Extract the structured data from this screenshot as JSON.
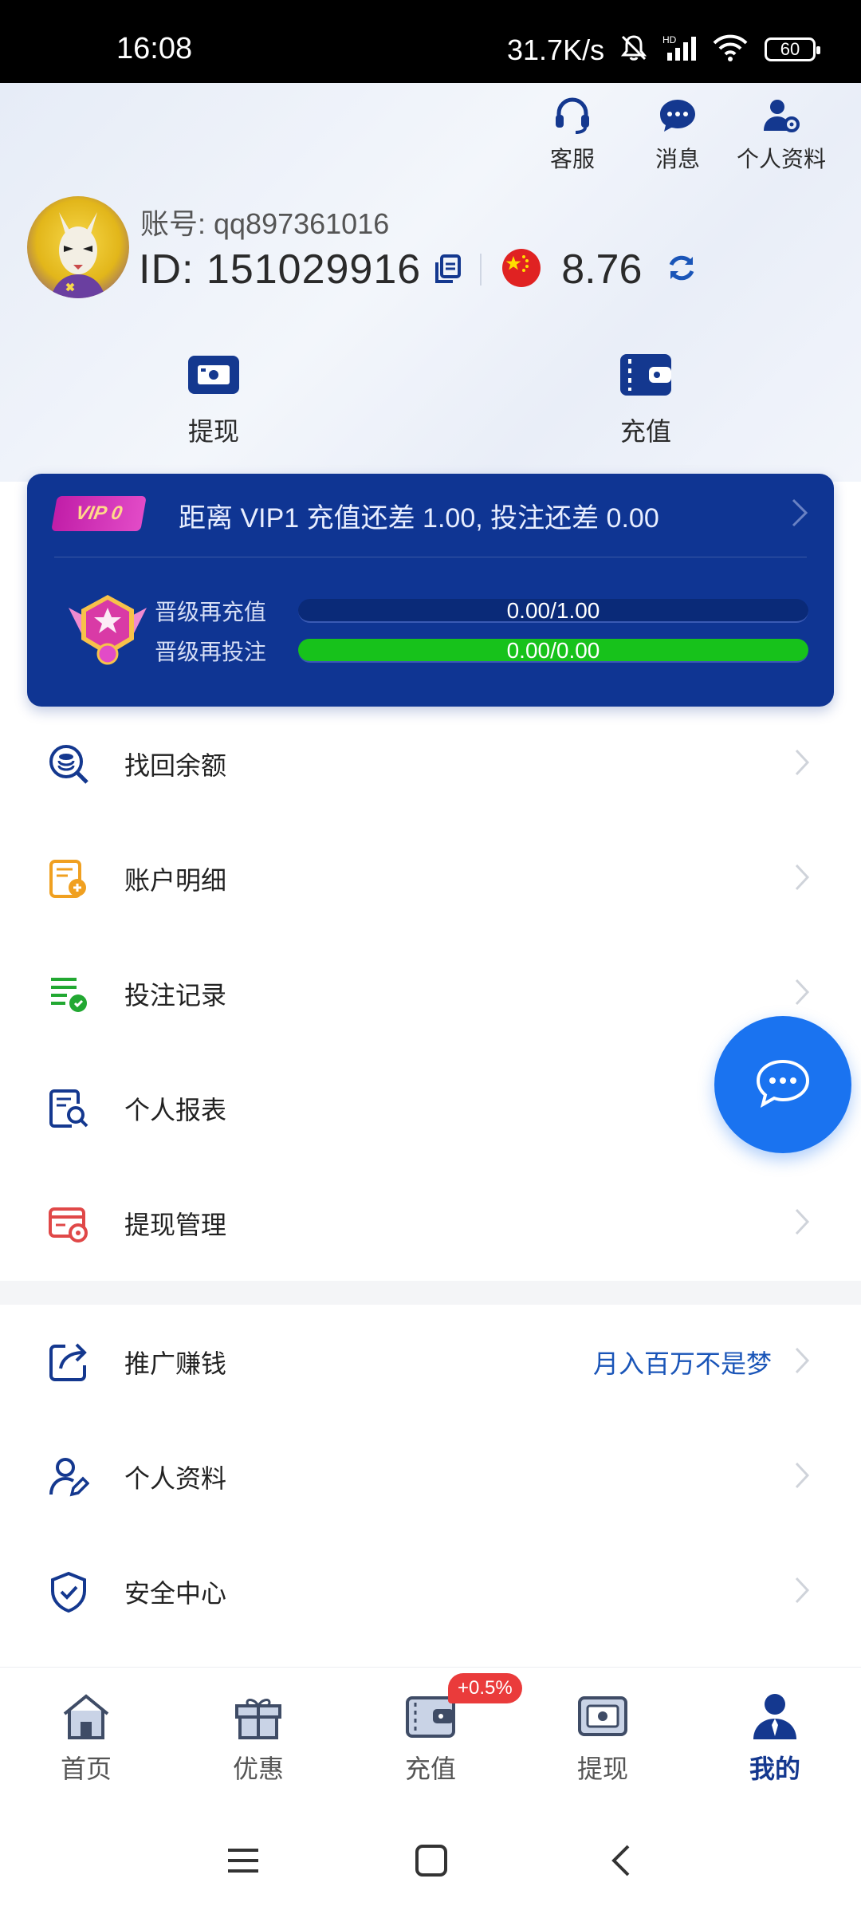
{
  "status_bar": {
    "time": "16:08",
    "net_speed": "31.7K/s",
    "battery": "60",
    "icons": [
      "mute-icon",
      "hd-signal-icon",
      "wifi-icon",
      "battery-icon"
    ]
  },
  "top_actions": {
    "customer_service": "客服",
    "messages": "消息",
    "profile": "个人资料"
  },
  "user": {
    "account": "账号: qq897361016",
    "id": "ID: 151029916",
    "balance": "8.76",
    "flag": "china-flag-icon"
  },
  "quick_actions": {
    "withdraw": "提现",
    "recharge": "充值"
  },
  "vip": {
    "badge": "VIP 0",
    "summary": "距离  VIP1  充值还差  1.00,  投注还差 0.00",
    "recharge_label": "晋级再充值",
    "recharge_value": "0.00/1.00",
    "recharge_progress": 0.0,
    "bet_label": "晋级再投注",
    "bet_value": "0.00/0.00",
    "bet_progress": 1.0
  },
  "menu": [
    {
      "label": "找回余额",
      "icon": "search-balance-icon"
    },
    {
      "label": "账户明细",
      "icon": "account-details-icon"
    },
    {
      "label": "投注记录",
      "icon": "bet-records-icon"
    },
    {
      "label": "个人报表",
      "icon": "personal-report-icon"
    },
    {
      "label": "提现管理",
      "icon": "withdraw-manage-icon"
    },
    {
      "label": "推广赚钱",
      "icon": "share-icon",
      "extra": "月入百万不是梦"
    },
    {
      "label": "个人资料",
      "icon": "user-edit-icon"
    },
    {
      "label": "安全中心",
      "icon": "shield-check-icon"
    }
  ],
  "tabs": {
    "home": "首页",
    "promo": "优惠",
    "recharge": "充值",
    "withdraw": "提现",
    "mine": "我的",
    "recharge_badge": "+0.5%"
  },
  "colors": {
    "primary": "#0f3593",
    "accent_blue": "#1a73f0",
    "progress_green": "#17c21b",
    "badge_red": "#ea3b3b"
  }
}
